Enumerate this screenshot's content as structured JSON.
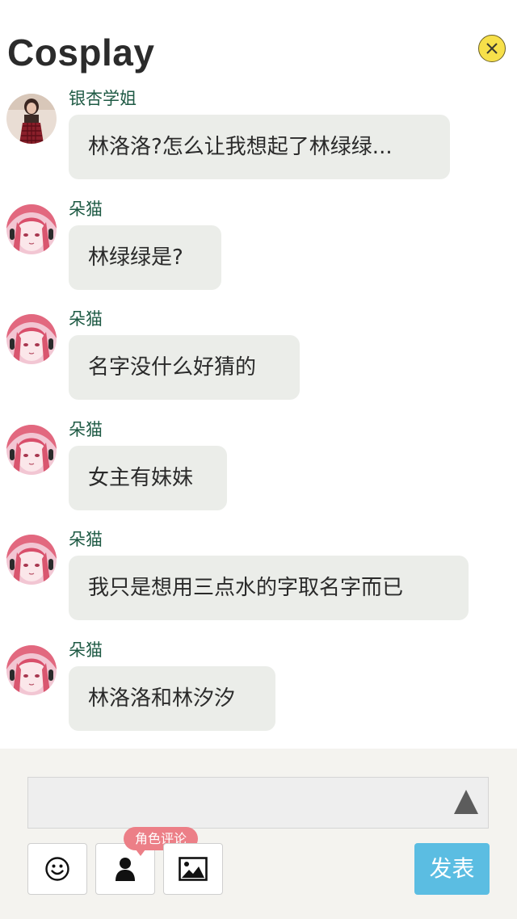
{
  "header": {
    "title": "Cosplay",
    "close_icon": "close-icon"
  },
  "messages": [
    {
      "user": "银杏学姐",
      "text": "林洛洛?怎么让我想起了林绿绿...",
      "avatar": "avatar-girl"
    },
    {
      "user": "朵猫",
      "text": "林绿绿是?",
      "avatar": "avatar-anime"
    },
    {
      "user": "朵猫",
      "text": "名字没什么好猜的",
      "avatar": "avatar-anime"
    },
    {
      "user": "朵猫",
      "text": "女主有妹妹",
      "avatar": "avatar-anime"
    },
    {
      "user": "朵猫",
      "text": "我只是想用三点水的字取名字而已",
      "avatar": "avatar-anime"
    },
    {
      "user": "朵猫",
      "text": "林洛洛和林汐汐",
      "avatar": "avatar-anime"
    }
  ],
  "composer": {
    "input_value": "",
    "send_icon": "triangle-up-icon",
    "role_comment_tag": "角色评论",
    "publish_label": "发表",
    "tools": [
      "smiley-icon",
      "person-icon",
      "image-icon"
    ]
  },
  "colors": {
    "bubble": "#ebede9",
    "username": "#1e5a44",
    "close_button": "#f7e04a",
    "tag": "#ec7f87",
    "publish": "#5bbde2"
  }
}
